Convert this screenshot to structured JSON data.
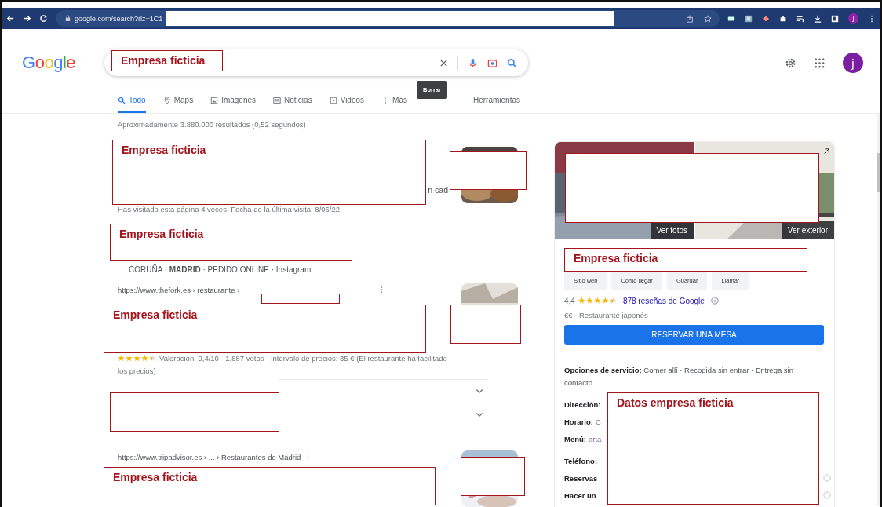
{
  "browser": {
    "url": "google.com/search?rlz=1C1",
    "avatar": "j"
  },
  "account": {
    "avatar": "j"
  },
  "logo": "Google",
  "search": {
    "tooltip": "Borrar"
  },
  "tabs": [
    {
      "label": "Todo",
      "selected": true
    },
    {
      "label": "Maps",
      "selected": false
    },
    {
      "label": "Imágenes",
      "selected": false
    },
    {
      "label": "Noticias",
      "selected": false
    },
    {
      "label": "Videos",
      "selected": false
    },
    {
      "label": "Más",
      "selected": false
    }
  ],
  "tools": "Herramientas",
  "stats": "Aproximadamente 3.880.000 resultados (0,52 segundos)",
  "results": [
    {
      "kind": "visited",
      "snippet": "n cad",
      "note": "Has visitado esta página 4 veces. Fecha de la última visita: 8/06/22."
    },
    {
      "kind": "sitelinks",
      "links": "CORUÑA · **MADRID** · PEDIDO ONLINE · Instagram."
    },
    {
      "kind": "rated",
      "url": "https://www.thefork.es › restaurante ›",
      "stars": 4.5,
      "details": "Valoración: 9,4/10 · 1.887 votos · Intervalo de precios: 35 € (El restaurante ha facilitado los precios)",
      "expanders": [
        {
          "expanded": false
        },
        {
          "expanded": false
        }
      ]
    },
    {
      "kind": "plain",
      "url": "https://www.tripadvisor.es › ... › Restaurantes de Madrid"
    }
  ],
  "panel": {
    "photos": "Ver fotos",
    "exterior": "Ver exterior",
    "actions": [
      "Sitio web",
      "Cómo llegar",
      "Guardar",
      "Llamar"
    ],
    "rating": "4,4",
    "stars": 4.5,
    "reviews": "878 reseñas de Google",
    "category": "€€ · Restaurante japonés",
    "reserve": "RESERVAR UNA MESA",
    "service_label": "Opciones de servicio:",
    "service": "Comer allí · Recogida sin entrar · Entrega sin contacto",
    "rows": [
      {
        "label": "Dirección:",
        "value": "",
        "info": false
      },
      {
        "label": "Horario:",
        "value": "C",
        "info": false
      },
      {
        "label": "Menú:",
        "value": "arta",
        "info": false
      },
      {
        "label": "Teléfono:",
        "value": "",
        "info": false
      },
      {
        "label": "Reservas",
        "value": "",
        "info": true
      },
      {
        "label": "Hacer un",
        "value": "",
        "info": true
      }
    ]
  },
  "redactions": [
    {
      "kind": "labeled",
      "label": "Empresa ficticia"
    },
    {
      "kind": "labeled",
      "label": "Empresa ficticia"
    },
    {
      "kind": "blank"
    },
    {
      "kind": "labeled",
      "label": "Empresa ficticia"
    },
    {
      "kind": "blank"
    },
    {
      "kind": "labeled",
      "label": "Empresa ficticia"
    },
    {
      "kind": "blank"
    },
    {
      "kind": "blank"
    },
    {
      "kind": "labeled",
      "label": "Empresa ficticia"
    },
    {
      "kind": "blank"
    },
    {
      "kind": "blank"
    },
    {
      "kind": "labeled",
      "label": "Empresa ficticia"
    },
    {
      "kind": "labeled",
      "label": "Datos empresa ficticia"
    }
  ]
}
